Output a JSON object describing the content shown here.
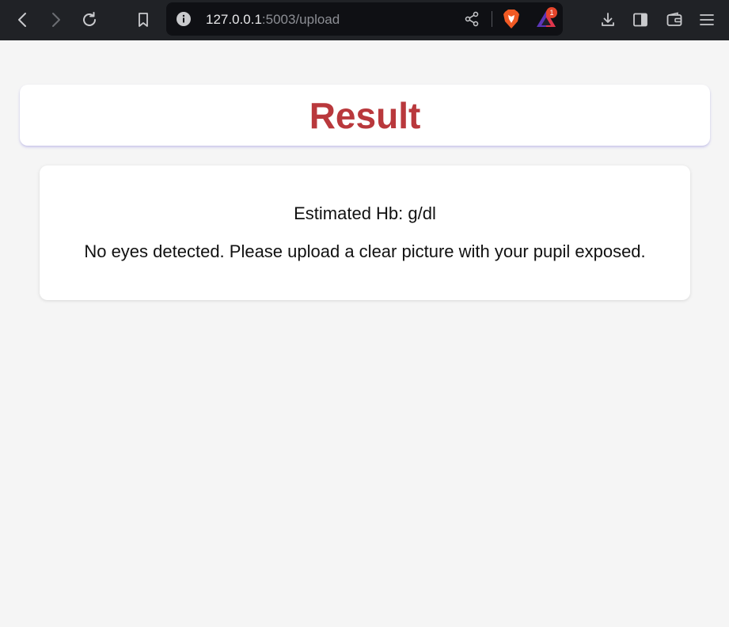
{
  "browser": {
    "url_host": "127.0.0.1",
    "url_rest": ":5003/upload",
    "rewards_badge": "1"
  },
  "header": {
    "title": "Result"
  },
  "result": {
    "hb_label": "Estimated Hb:",
    "hb_value": "",
    "hb_unit": "g/dl",
    "message": "No eyes detected. Please upload a clear picture with your pupil exposed."
  },
  "colors": {
    "title": "#b9383c",
    "toolbar": "#202226",
    "page_background": "#f5f5f5"
  },
  "icons": [
    "back-icon",
    "forward-icon",
    "reload-icon",
    "bookmark-icon",
    "info-icon",
    "share-icon",
    "brave-shields-icon",
    "brave-rewards-icon",
    "download-icon",
    "sidebar-icon",
    "wallet-icon",
    "menu-icon"
  ]
}
